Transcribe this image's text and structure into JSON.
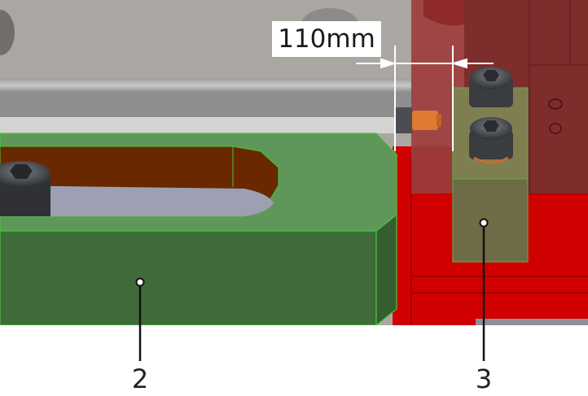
{
  "dimension": {
    "label": "110mm"
  },
  "callouts": [
    {
      "label": "2"
    },
    {
      "label": "3"
    }
  ],
  "colors": {
    "plate_gray": "#a9a6a2",
    "rail_gray": "#8f8f91",
    "green_part": "#5f9659",
    "green_dark": "#3f6a3a",
    "green_edge": "#46c83a",
    "red_part": "#d40000",
    "red_translucent": "#9e3a3a",
    "slot_brown": "#6a2800",
    "slot_inner": "#9c9eb0",
    "bracket_olive": "#6e6e48",
    "bolt_gray": "#4a4d52",
    "pin_orange": "#e07a30"
  }
}
